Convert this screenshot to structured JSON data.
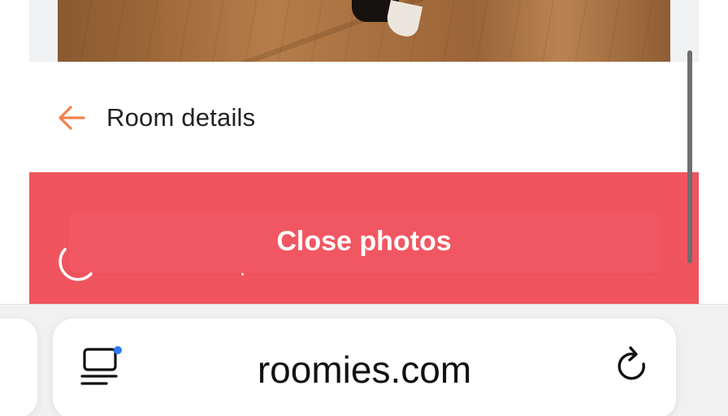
{
  "header": {
    "title": "Room details",
    "back_icon": "arrow-left-icon",
    "accent_color": "#f0834e"
  },
  "photos": {
    "close_label": "Close photos",
    "close_background": "#f0545f",
    "loading_icon": "spinner-icon"
  },
  "browser": {
    "url": "roomies.com",
    "reader_icon": "reader-mode-icon",
    "reader_badge_color": "#2f7bf6",
    "reload_icon": "reload-icon"
  }
}
